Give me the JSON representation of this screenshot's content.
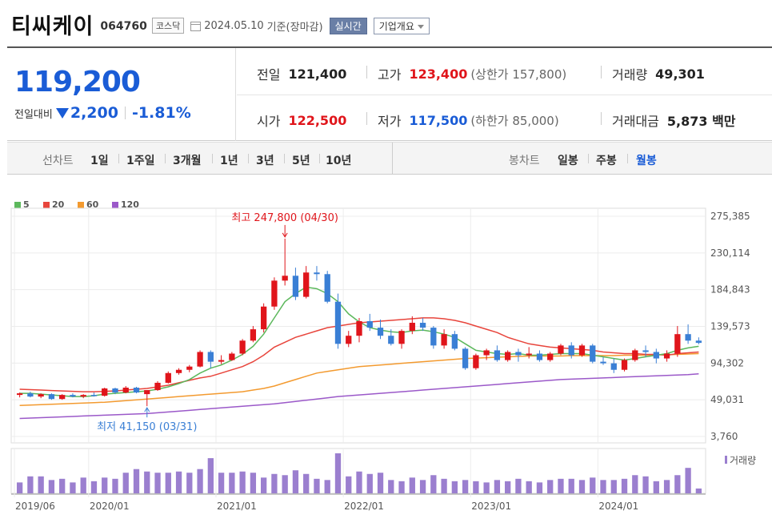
{
  "header": {
    "name": "티씨케이",
    "code": "064760",
    "market": "코스닥",
    "date": "2024.05.10",
    "basis": "기준(장마감)",
    "realtime_label": "실시간",
    "company_label": "기업개요"
  },
  "summary": {
    "price": "119,200",
    "change_label": "전일대비",
    "change": "2,200",
    "change_pct": "-1.81%",
    "prev_label": "전일",
    "prev": "121,400",
    "high_label": "고가",
    "high": "123,400",
    "upper_limit": "(상한가 157,800)",
    "volume_label": "거래량",
    "volume": "49,301",
    "open_label": "시가",
    "open": "122,500",
    "low_label": "저가",
    "low": "117,500",
    "lower_limit": "(하한가 85,000)",
    "amount_label": "거래대금",
    "amount": "5,873 백만"
  },
  "tabs": {
    "line_chart_label": "선차트",
    "line_periods": [
      "1일",
      "1주일",
      "3개월",
      "1년",
      "3년",
      "5년",
      "10년"
    ],
    "candle_label": "봉차트",
    "candle_periods": [
      "일봉",
      "주봉",
      "월봉"
    ],
    "selected_candle": "월봉"
  },
  "chart_data": {
    "type": "candlestick",
    "title": "",
    "y_ticks": [
      "275,385",
      "230,114",
      "184,843",
      "139,573",
      "94,302",
      "49,031",
      "3,760"
    ],
    "y_tick_values": [
      275385,
      230114,
      184843,
      139573,
      94302,
      49031,
      3760
    ],
    "x_ticks": [
      "2019/06",
      "2020/01",
      "2021/01",
      "2022/01",
      "2023/01",
      "2024/01"
    ],
    "legend": [
      {
        "name": "5",
        "color": "#5cb85c"
      },
      {
        "name": "20",
        "color": "#e8453c"
      },
      {
        "name": "60",
        "color": "#f39a2f"
      },
      {
        "name": "120",
        "color": "#9b59c9"
      }
    ],
    "annotation_high": "최고 247,800 (04/30)",
    "annotation_low": "최저 41,150 (03/31)",
    "volume_label": "거래량",
    "colors": {
      "up": "#e0151b",
      "down": "#3a7fd5",
      "volume": "#9b7fcf"
    },
    "candles": [
      [
        55000,
        58000,
        52000,
        57000
      ],
      [
        57000,
        59000,
        52000,
        53000
      ],
      [
        53000,
        57000,
        51000,
        56000
      ],
      [
        56000,
        57000,
        49000,
        50000
      ],
      [
        50000,
        56000,
        49000,
        55000
      ],
      [
        55000,
        57000,
        52000,
        53000
      ],
      [
        53000,
        56000,
        51000,
        55000
      ],
      [
        55000,
        58000,
        53000,
        54000
      ],
      [
        54000,
        64000,
        53000,
        63000
      ],
      [
        63000,
        64000,
        56000,
        58000
      ],
      [
        58000,
        66000,
        57000,
        64000
      ],
      [
        64000,
        65000,
        57000,
        58000
      ],
      [
        56000,
        60000,
        41150,
        61000
      ],
      [
        61000,
        72000,
        60000,
        70000
      ],
      [
        70000,
        84000,
        69000,
        82000
      ],
      [
        82000,
        88000,
        80000,
        86000
      ],
      [
        86000,
        92000,
        83000,
        90000
      ],
      [
        90000,
        110000,
        89000,
        108000
      ],
      [
        108000,
        110000,
        88000,
        96000
      ],
      [
        96000,
        104000,
        93000,
        98000
      ],
      [
        98000,
        108000,
        97000,
        106000
      ],
      [
        106000,
        124000,
        104000,
        122000
      ],
      [
        122000,
        140000,
        120000,
        136000
      ],
      [
        136000,
        168000,
        132000,
        164000
      ],
      [
        164000,
        200000,
        160000,
        196000
      ],
      [
        196000,
        247800,
        190000,
        202000
      ],
      [
        202000,
        212000,
        172000,
        176000
      ],
      [
        176000,
        214000,
        174000,
        206000
      ],
      [
        206000,
        214000,
        196000,
        204000
      ],
      [
        204000,
        208000,
        168000,
        170000
      ],
      [
        170000,
        180000,
        112000,
        118000
      ],
      [
        118000,
        134000,
        114000,
        128000
      ],
      [
        128000,
        150000,
        120000,
        146000
      ],
      [
        146000,
        155000,
        134000,
        138000
      ],
      [
        138000,
        148000,
        124000,
        128000
      ],
      [
        128000,
        136000,
        116000,
        118000
      ],
      [
        118000,
        136000,
        112000,
        134000
      ],
      [
        134000,
        152000,
        130000,
        144000
      ],
      [
        144000,
        150000,
        134000,
        138000
      ],
      [
        138000,
        140000,
        112000,
        116000
      ],
      [
        116000,
        136000,
        112000,
        130000
      ],
      [
        130000,
        134000,
        110000,
        112000
      ],
      [
        112000,
        114000,
        86000,
        88000
      ],
      [
        88000,
        106000,
        86000,
        104000
      ],
      [
        104000,
        112000,
        98000,
        110000
      ],
      [
        110000,
        116000,
        96000,
        98000
      ],
      [
        98000,
        110000,
        96000,
        108000
      ],
      [
        108000,
        112000,
        96000,
        104000
      ],
      [
        104000,
        114000,
        100000,
        106000
      ],
      [
        106000,
        110000,
        96000,
        98000
      ],
      [
        98000,
        108000,
        96000,
        106000
      ],
      [
        106000,
        118000,
        104000,
        116000
      ],
      [
        116000,
        120000,
        100000,
        104000
      ],
      [
        104000,
        118000,
        102000,
        116000
      ],
      [
        116000,
        118000,
        94000,
        96000
      ],
      [
        96000,
        102000,
        92000,
        94000
      ],
      [
        94000,
        100000,
        82000,
        86000
      ],
      [
        86000,
        100000,
        84000,
        98000
      ],
      [
        98000,
        112000,
        96000,
        110000
      ],
      [
        110000,
        116000,
        102000,
        108000
      ],
      [
        108000,
        112000,
        94000,
        100000
      ],
      [
        100000,
        110000,
        96000,
        106000
      ],
      [
        106000,
        140000,
        102000,
        130000
      ],
      [
        130000,
        142000,
        118000,
        122000
      ],
      [
        122000,
        126000,
        117500,
        119200
      ]
    ],
    "volume": [
      18,
      28,
      28,
      22,
      24,
      18,
      26,
      20,
      26,
      24,
      34,
      40,
      36,
      34,
      34,
      36,
      34,
      40,
      58,
      34,
      34,
      36,
      34,
      26,
      32,
      30,
      38,
      32,
      24,
      22,
      66,
      28,
      36,
      32,
      34,
      22,
      20,
      26,
      22,
      30,
      24,
      20,
      22,
      20,
      18,
      22,
      20,
      24,
      20,
      18,
      22,
      24,
      24,
      22,
      26,
      22,
      22,
      24,
      30,
      28,
      20,
      22,
      30,
      42,
      8
    ],
    "ma5": [
      57000,
      57000,
      56000,
      55000,
      54000,
      53000,
      53000,
      54000,
      56000,
      57000,
      58000,
      59000,
      60000,
      62000,
      65000,
      69000,
      74000,
      82000,
      88000,
      92000,
      98000,
      105000,
      115000,
      130000,
      150000,
      170000,
      180000,
      188000,
      186000,
      180000,
      170000,
      155000,
      145000,
      138000,
      135000,
      133000,
      132000,
      134000,
      135000,
      133000,
      130000,
      126000,
      118000,
      110000,
      108000,
      106000,
      105000,
      106000,
      104000,
      104000,
      105000,
      106000,
      106000,
      106000,
      104000,
      102000,
      100000,
      98000,
      100000,
      102000,
      104000,
      106000,
      110000,
      113000,
      115000
    ],
    "ma20": [
      62000,
      61500,
      61000,
      60500,
      60000,
      59500,
      59000,
      59000,
      59500,
      60000,
      61000,
      62000,
      63000,
      65000,
      67000,
      70000,
      73000,
      76000,
      78000,
      82000,
      86000,
      90000,
      96000,
      104000,
      114000,
      120000,
      126000,
      130000,
      134000,
      138000,
      140000,
      142000,
      144000,
      145000,
      146000,
      147000,
      148000,
      149000,
      150000,
      150000,
      149000,
      147000,
      144000,
      140000,
      136000,
      132000,
      126000,
      122000,
      118000,
      116000,
      114000,
      113000,
      112000,
      111000,
      110000,
      108000,
      107000,
      106000,
      106000,
      105000,
      105000,
      104000,
      106000,
      107000,
      108000
    ],
    "ma60": [
      42000,
      42500,
      43000,
      43500,
      44000,
      44500,
      45000,
      45500,
      46000,
      47000,
      48000,
      49000,
      50000,
      51000,
      52000,
      53000,
      54000,
      55000,
      56000,
      57000,
      58000,
      59000,
      61000,
      63000,
      66000,
      70000,
      74000,
      78000,
      82000,
      84000,
      86000,
      88000,
      90000,
      91000,
      92000,
      93000,
      94000,
      95000,
      96000,
      97000,
      98000,
      99000,
      100000,
      100500,
      101000,
      101500,
      102000,
      102500,
      103000,
      103000,
      103000,
      103000,
      103500,
      103500,
      103500,
      103500,
      103500,
      104000,
      104000,
      104000,
      104500,
      104500,
      105000,
      105500,
      106000
    ],
    "ma120": [
      26000,
      26500,
      27000,
      27500,
      28000,
      28500,
      29000,
      29500,
      30000,
      30500,
      31000,
      31500,
      32000,
      33000,
      34000,
      35000,
      36000,
      37000,
      38000,
      39000,
      40000,
      41000,
      42000,
      43000,
      44000,
      45500,
      47000,
      48500,
      50000,
      51500,
      53000,
      54000,
      55000,
      56000,
      57000,
      58000,
      59000,
      60000,
      61000,
      62000,
      63000,
      64000,
      65000,
      66000,
      67000,
      68000,
      69000,
      70000,
      71000,
      72000,
      73000,
      74000,
      74500,
      75000,
      75500,
      76000,
      76500,
      77000,
      77500,
      78000,
      78500,
      79000,
      79500,
      80000,
      81000
    ]
  }
}
